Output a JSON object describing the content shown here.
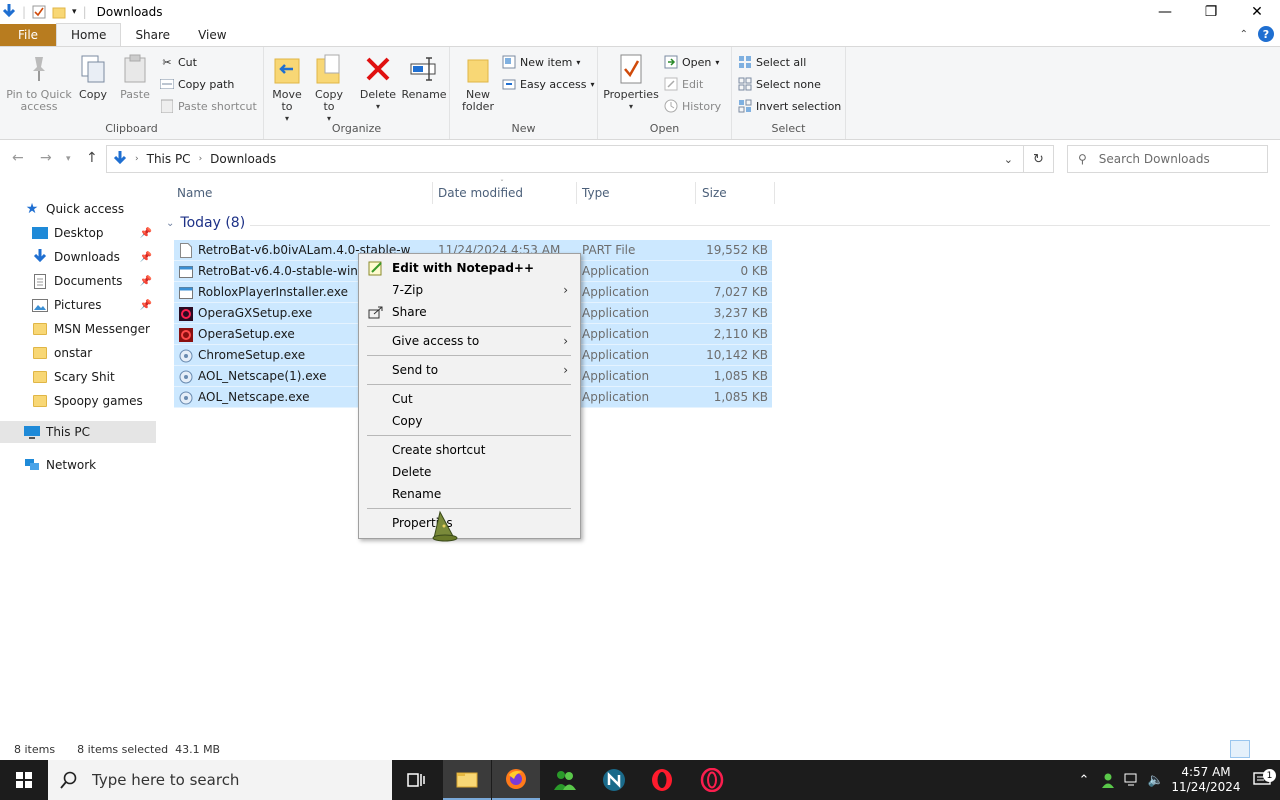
{
  "window": {
    "title": "Downloads",
    "minimize": "—",
    "restore": "❐",
    "close": "✕"
  },
  "ribbon_tabs": [
    "File",
    "Home",
    "Share",
    "View"
  ],
  "ribbon": {
    "clipboard": {
      "label": "Clipboard",
      "pin": "Pin to Quick access",
      "copy": "Copy",
      "paste": "Paste",
      "cut": "Cut",
      "copy_path": "Copy path",
      "paste_shortcut": "Paste shortcut"
    },
    "organize": {
      "label": "Organize",
      "move_to": "Move to",
      "copy_to": "Copy to",
      "delete": "Delete",
      "rename": "Rename"
    },
    "new": {
      "label": "New",
      "new_folder": "New folder",
      "new_item": "New item",
      "easy_access": "Easy access"
    },
    "open": {
      "label": "Open",
      "properties": "Properties",
      "open": "Open",
      "edit": "Edit",
      "history": "History"
    },
    "select": {
      "label": "Select",
      "select_all": "Select all",
      "select_none": "Select none",
      "invert": "Invert selection"
    }
  },
  "address": {
    "crumbs": [
      "This PC",
      "Downloads"
    ],
    "search_placeholder": "Search Downloads"
  },
  "nav": {
    "quick_access": "Quick access",
    "items": [
      "Desktop",
      "Downloads",
      "Documents",
      "Pictures",
      "MSN Messenger",
      "onstar",
      "Scary Shit",
      "Spoopy games"
    ],
    "this_pc": "This PC",
    "network": "Network"
  },
  "columns": {
    "name": "Name",
    "date": "Date modified",
    "type": "Type",
    "size": "Size"
  },
  "group": {
    "label": "Today (8)"
  },
  "files": [
    {
      "name": "RetroBat-v6.b0ivALam.4.0-stable-win64-",
      "date": "11/24/2024 4:53 AM",
      "type": "PART File",
      "size": "19,552 KB"
    },
    {
      "name": "RetroBat-v6.4.0-stable-win64-setup.exe",
      "date": "",
      "type": "Application",
      "size": "0 KB"
    },
    {
      "name": "RobloxPlayerInstaller.exe",
      "date": "",
      "type": "Application",
      "size": "7,027 KB"
    },
    {
      "name": "OperaGXSetup.exe",
      "date": "",
      "type": "Application",
      "size": "3,237 KB"
    },
    {
      "name": "OperaSetup.exe",
      "date": "",
      "type": "Application",
      "size": "2,110 KB"
    },
    {
      "name": "ChromeSetup.exe",
      "date": "",
      "type": "Application",
      "size": "10,142 KB"
    },
    {
      "name": "AOL_Netscape(1).exe",
      "date": "",
      "type": "Application",
      "size": "1,085 KB"
    },
    {
      "name": "AOL_Netscape.exe",
      "date": "",
      "type": "Application",
      "size": "1,085 KB"
    }
  ],
  "context_menu": {
    "edit_notepad": "Edit with Notepad++",
    "zip": "7-Zip",
    "share": "Share",
    "give_access": "Give access to",
    "send_to": "Send to",
    "cut": "Cut",
    "copy": "Copy",
    "create_shortcut": "Create shortcut",
    "delete": "Delete",
    "rename": "Rename",
    "properties": "Properties"
  },
  "status": {
    "items": "8 items",
    "selected": "8 items selected  43.1 MB"
  },
  "taskbar": {
    "search_placeholder": "Type here to search",
    "time": "4:57 AM",
    "date": "11/24/2024",
    "notifications": "1"
  }
}
